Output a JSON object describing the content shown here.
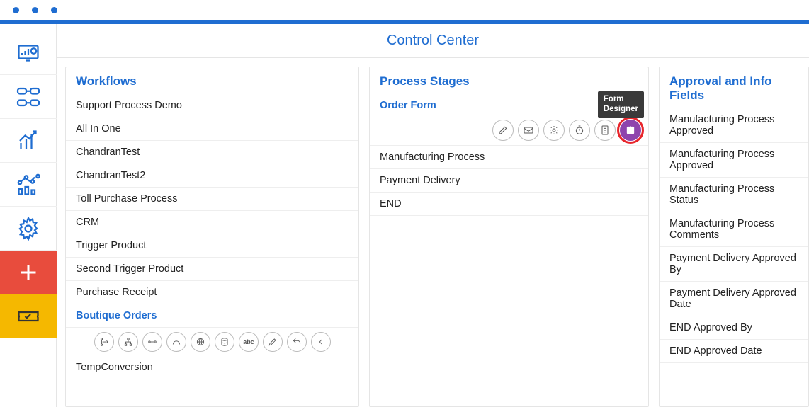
{
  "header": {
    "title": "Control Center"
  },
  "tooltip": "Form\nDesigner",
  "panels": {
    "workflows": {
      "title": "Workflows"
    },
    "stages": {
      "title": "Process Stages"
    },
    "fields": {
      "title": "Approval and Info Fields"
    }
  },
  "workflows": [
    "Support Process Demo",
    "All In One",
    "ChandranTest",
    "ChandranTest2",
    "Toll Purchase Process",
    "CRM",
    "Trigger Product",
    "Second Trigger Product",
    "Purchase Receipt",
    "Boutique Orders",
    "TempConversion"
  ],
  "workflows_selected_index": 9,
  "stages": [
    "Order Form",
    "Manufacturing Process",
    "Payment Delivery",
    "END"
  ],
  "stages_selected_index": 0,
  "fields": [
    "Manufacturing Process Approved",
    "Manufacturing Process Approved",
    "Manufacturing Process Status",
    "Manufacturing Process Comments",
    "Payment Delivery Approved By",
    "Payment Delivery Approved Date",
    "END Approved By",
    "END Approved Date"
  ],
  "wf_tool_icons": [
    "branch",
    "hierarchy",
    "connector",
    "arc",
    "globe",
    "stack",
    "abc",
    "edit",
    "undo",
    "back"
  ],
  "stage_tool_icons": [
    "edit",
    "mail",
    "settings",
    "timer",
    "form",
    "form-designer"
  ]
}
